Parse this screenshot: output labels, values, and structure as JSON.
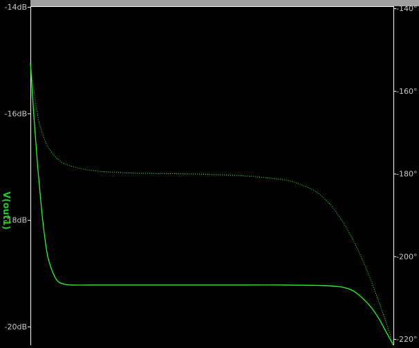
{
  "window": {
    "background": "#000000",
    "frame_color": "#ffffff",
    "top_strip_color": "#a0a0a0"
  },
  "chart_data": {
    "type": "line",
    "ylabel": "V(out1)",
    "ylabel_color": "#22cc22",
    "trace_color": "#22ff22",
    "axis_color": "#ffffff",
    "tick_label_color": "#c8c8c8",
    "grid": false,
    "left_axis": {
      "unit": "dB",
      "range": [
        -20.35,
        -14
      ],
      "ticks": [
        {
          "value": -14,
          "label": "-14dB"
        },
        {
          "value": -16,
          "label": "-16dB"
        },
        {
          "value": -18,
          "label": "-18dB"
        },
        {
          "value": -20,
          "label": "-20dB"
        }
      ]
    },
    "right_axis": {
      "unit": "deg",
      "range": [
        -221.5,
        -140
      ],
      "ticks": [
        {
          "value": -140,
          "label": "-140°"
        },
        {
          "value": -160,
          "label": "-160°"
        },
        {
          "value": -180,
          "label": "-180°"
        },
        {
          "value": -200,
          "label": "-200°"
        },
        {
          "value": -220,
          "label": "-220°"
        }
      ]
    },
    "series": [
      {
        "id": "magnitude",
        "style": "solid",
        "axis": "left",
        "x": [
          0,
          0.01,
          0.02,
          0.03,
          0.04,
          0.05,
          0.07,
          0.09,
          0.12,
          0.16,
          0.2,
          0.3,
          0.4,
          0.5,
          0.6,
          0.7,
          0.8,
          0.85,
          0.88,
          0.9,
          0.92,
          0.94,
          0.96,
          0.98,
          1.0
        ],
        "values": [
          -15.05,
          -16.1,
          -17.0,
          -17.75,
          -18.35,
          -18.75,
          -19.1,
          -19.2,
          -19.22,
          -19.22,
          -19.22,
          -19.22,
          -19.22,
          -19.22,
          -19.22,
          -19.22,
          -19.23,
          -19.25,
          -19.3,
          -19.38,
          -19.5,
          -19.65,
          -19.85,
          -20.1,
          -20.35
        ]
      },
      {
        "id": "phase",
        "style": "dotted",
        "axis": "right",
        "x": [
          0,
          0.02,
          0.04,
          0.06,
          0.08,
          0.1,
          0.13,
          0.16,
          0.2,
          0.3,
          0.4,
          0.5,
          0.6,
          0.7,
          0.74,
          0.78,
          0.81,
          0.84,
          0.87,
          0.9,
          0.93,
          0.96,
          0.98,
          1.0
        ],
        "values": [
          -153.5,
          -166,
          -172,
          -175,
          -176.8,
          -177.8,
          -178.6,
          -179.1,
          -179.5,
          -179.9,
          -180,
          -180.2,
          -180.6,
          -181.5,
          -182.5,
          -184,
          -186,
          -189,
          -193,
          -198,
          -204,
          -211,
          -216,
          -221.5
        ]
      }
    ]
  }
}
